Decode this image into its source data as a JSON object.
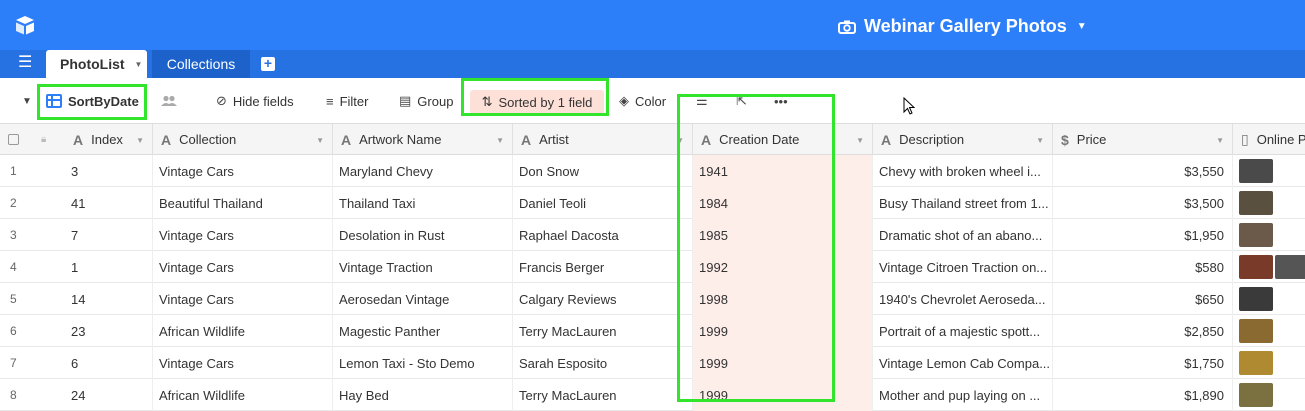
{
  "base": {
    "title": "Webinar Gallery Photos"
  },
  "tabs": {
    "active": "PhotoList",
    "other": "Collections"
  },
  "toolbar": {
    "view_name": "SortByDate",
    "hide_fields": "Hide fields",
    "filter": "Filter",
    "group": "Group",
    "sorted": "Sorted by 1 field",
    "color": "Color"
  },
  "columns": [
    "Index",
    "Collection",
    "Artwork Name",
    "Artist",
    "Creation Date",
    "Description",
    "Price",
    "Online P"
  ],
  "rows": [
    {
      "n": "1",
      "index": "3",
      "collection": "Vintage Cars",
      "artwork": "Maryland Chevy",
      "artist": "Don Snow",
      "date": "1941",
      "description": "Chevy with broken wheel i...",
      "price": "$3,550",
      "thumbs": [
        "#4a4a4a"
      ]
    },
    {
      "n": "2",
      "index": "41",
      "collection": "Beautiful Thailand",
      "artwork": "Thailand Taxi",
      "artist": "Daniel Teoli",
      "date": "1984",
      "description": "Busy Thailand street from 1...",
      "price": "$3,500",
      "thumbs": [
        "#5a5040"
      ]
    },
    {
      "n": "3",
      "index": "7",
      "collection": "Vintage Cars",
      "artwork": "Desolation in Rust",
      "artist": "Raphael Dacosta",
      "date": "1985",
      "description": "Dramatic shot of an abano...",
      "price": "$1,950",
      "thumbs": [
        "#6b5a4a"
      ]
    },
    {
      "n": "4",
      "index": "1",
      "collection": "Vintage Cars",
      "artwork": "Vintage Traction",
      "artist": "Francis Berger",
      "date": "1992",
      "description": "Vintage Citroen Traction on...",
      "price": "$580",
      "thumbs": [
        "#7a3a2a",
        "#555555"
      ]
    },
    {
      "n": "5",
      "index": "14",
      "collection": "Vintage Cars",
      "artwork": "Aerosedan Vintage",
      "artist": "Calgary Reviews",
      "date": "1998",
      "description": "1940's Chevrolet Aeroseda...",
      "price": "$650",
      "thumbs": [
        "#3a3a3a"
      ]
    },
    {
      "n": "6",
      "index": "23",
      "collection": "African Wildlife",
      "artwork": "Magestic Panther",
      "artist": "Terry MacLauren",
      "date": "1999",
      "description": "Portrait of a majestic spott...",
      "price": "$2,850",
      "thumbs": [
        "#8a6a30"
      ]
    },
    {
      "n": "7",
      "index": "6",
      "collection": "Vintage Cars",
      "artwork": "Lemon Taxi - Sto Demo",
      "artist": "Sarah Esposito",
      "date": "1999",
      "description": "Vintage Lemon Cab Compa...",
      "price": "$1,750",
      "thumbs": [
        "#b08a30"
      ]
    },
    {
      "n": "8",
      "index": "24",
      "collection": "African Wildlife",
      "artwork": "Hay Bed",
      "artist": "Terry MacLauren",
      "date": "1999",
      "description": "Mother and pup laying on ...",
      "price": "$1,890",
      "thumbs": [
        "#7a7040"
      ]
    }
  ]
}
